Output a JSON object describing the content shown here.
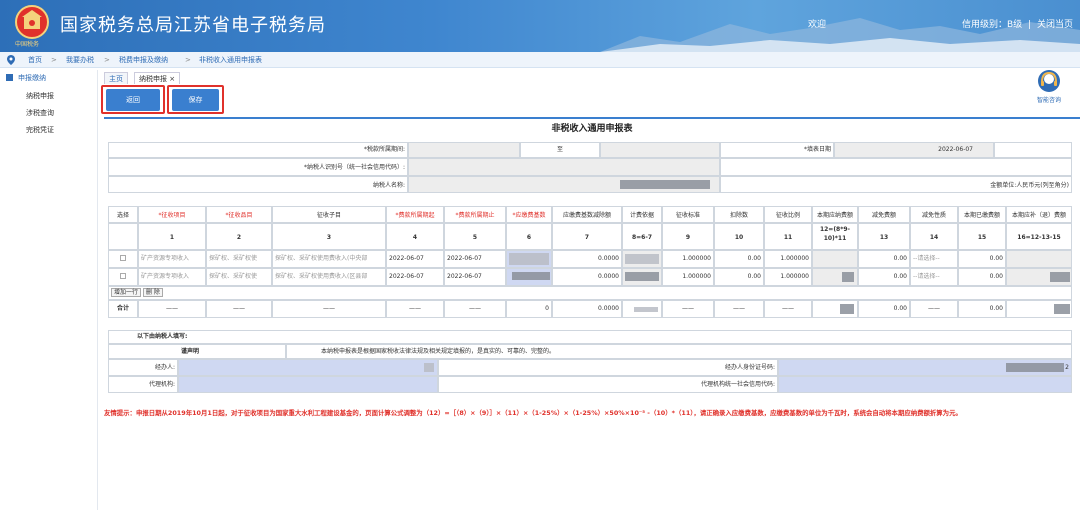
{
  "header": {
    "title": "国家税务总局江苏省电子税务局",
    "logo_text": "中国税务",
    "welcome": "欢迎",
    "credit": "信用级别：B级",
    "exit": "关闭当页"
  },
  "breadcrumb": {
    "items": [
      "首页",
      "我要办税",
      "税费申报及缴纳",
      "非税收入通用申报表"
    ],
    "sep": ">"
  },
  "sidebar": {
    "group": "申报缴纳",
    "items": [
      "纳税申报",
      "涉税查询",
      "完税凭证"
    ]
  },
  "tabs": [
    {
      "label": "主页"
    },
    {
      "label": "纳税申报 ×"
    }
  ],
  "toolbar": {
    "back_label": "返回",
    "save_label": "保存"
  },
  "assistant": {
    "label": "智能咨询"
  },
  "form": {
    "title": "非税收入通用申报表",
    "period_label": "*税款所属期间:",
    "period_to": "至",
    "fill_date_label": "*填表日期",
    "fill_date": "2022-06-07",
    "taxpayer_id_label": "*纳税人识别号（统一社会信用代码）:",
    "taxpayer_name_label": "纳税人名称:",
    "amount_unit": "金额单位:人民币元(列至角分)"
  },
  "table": {
    "headers": [
      "选择",
      "*征收项目",
      "*征收品目",
      "征收子目",
      "*费款所属期起",
      "*费款所属期止",
      "*应缴费基数",
      "应缴费基数减除额",
      "计费依据",
      "征收标准",
      "扣除数",
      "征收比例",
      "本期应纳费额",
      "减免费额",
      "减免性质",
      "本期已缴费额",
      "本期应补（退）费额"
    ],
    "col_nums": [
      "",
      "1",
      "2",
      "3",
      "4",
      "5",
      "6",
      "7",
      "8=6-7",
      "9",
      "10",
      "11",
      "12=(8*9-10)*11",
      "13",
      "14",
      "15",
      "16=12-13-15"
    ],
    "rows": [
      {
        "proj": "矿产资源专项收入",
        "item": "探矿权、采矿权使",
        "sub": "探矿权、采矿权使用费收入(中央部",
        "start": "2022-06-07",
        "end": "2022-06-07",
        "deduct": "0.0000",
        "std": "1.000000",
        "minus": "0.00",
        "ratio": "1.000000",
        "relief": "0.00",
        "nature": "--请选择--",
        "paid": "0.00"
      },
      {
        "proj": "矿产资源专项收入",
        "item": "探矿权、采矿权使",
        "sub": "探矿权、采矿权使用费收入(区县部",
        "start": "2022-06-07",
        "end": "2022-06-07",
        "deduct": "0.0000",
        "std": "1.000000",
        "minus": "0.00",
        "ratio": "1.000000",
        "relief": "0.00",
        "nature": "--请选择--",
        "paid": "0.00"
      }
    ],
    "add_row": "增加一行",
    "delete_row": "删 除",
    "total": {
      "label": "合计",
      "dash": "——",
      "base_tail": "0",
      "deduct": "0.0000",
      "relief": "0.00",
      "paid": "0.00"
    }
  },
  "declaration": {
    "section": "以下由纳税人填写:",
    "label": "谨声明",
    "text": "本纳税申报表是根据国家税收法律法规及相关规定填报的，是真实的、可靠的、完整的。",
    "agent": "经办人:",
    "agent_id": "经办人身份证号码:",
    "agency": "代理机构:",
    "agency_code": "代理机构统一社会信用代码:",
    "id_tail": "2"
  },
  "tip": "友情提示：申报日期从2019年10月1日起，对于征收项目为国家重大水利工程建设基金的，页面计算公式调整为（12）=［（8）×（9）］×（11）×（1-25%）×（1-25%）×50%×10⁻⁵ -（10）*（11），请正确录入应缴费基数，应缴费基数的单位为千瓦时，系统会自动将本期应纳费额折算为元。"
}
